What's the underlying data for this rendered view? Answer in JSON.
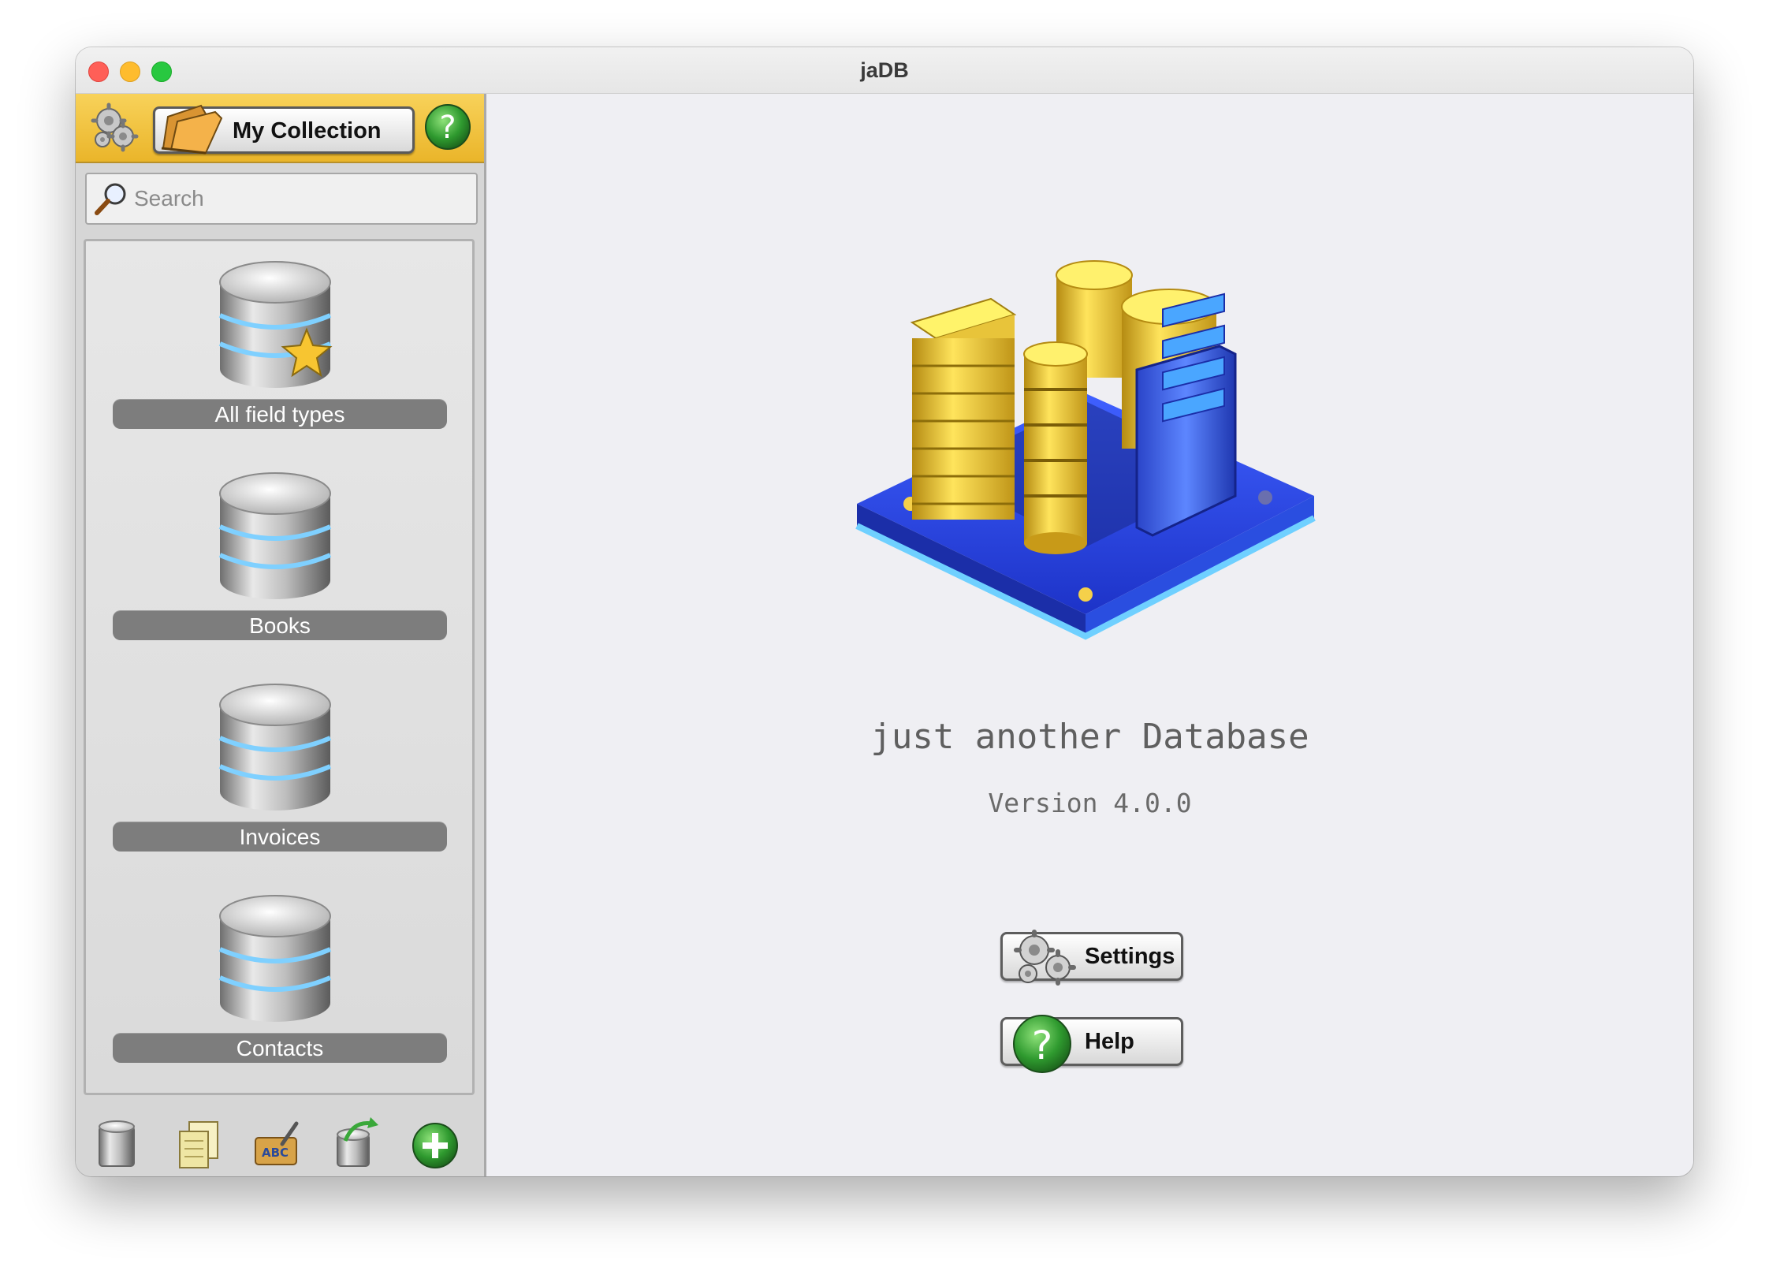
{
  "window": {
    "title": "jaDB"
  },
  "sidebar": {
    "collection_label": "My Collection",
    "search": {
      "placeholder": "Search"
    },
    "databases": [
      {
        "label": "All field types",
        "icon": "database-star-icon"
      },
      {
        "label": "Books",
        "icon": "database-icon"
      },
      {
        "label": "Invoices",
        "icon": "database-icon"
      },
      {
        "label": "Contacts",
        "icon": "database-icon"
      }
    ],
    "toolbar_icons": [
      "delete-database-icon",
      "duplicate-icon",
      "rename-icon",
      "import-database-icon",
      "add-database-icon"
    ]
  },
  "main": {
    "tagline": "just another Database",
    "version": "Version 4.0.0",
    "settings_label": "Settings",
    "help_label": "Help"
  },
  "colors": {
    "topbar_yellow": "#f2c443",
    "label_gray": "#7d7d7d",
    "accent_blue": "#2a47e6",
    "help_green": "#2f9a2f"
  }
}
